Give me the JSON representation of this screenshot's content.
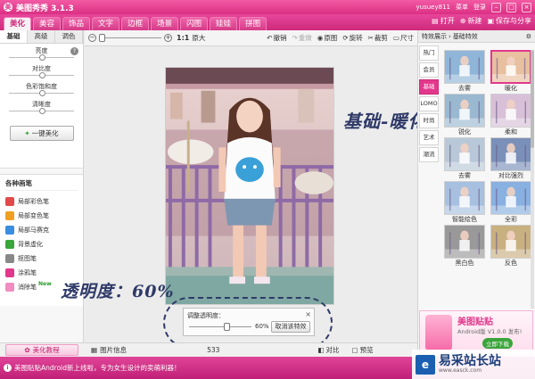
{
  "titlebar": {
    "title": "美图秀秀 3.1.3",
    "user": "yusuey811",
    "menu": "菜单",
    "login": "登录"
  },
  "menu": {
    "tabs": [
      "美化",
      "美容",
      "饰品",
      "文字",
      "边框",
      "场景",
      "闪图",
      "娃娃",
      "拼图"
    ],
    "active": 0,
    "open": "打开",
    "new": "新建",
    "save_share": "保存与分享"
  },
  "left": {
    "subtabs": [
      "基础",
      "高级",
      "调色"
    ],
    "sliders": [
      {
        "label": "亮度",
        "value": 0.5
      },
      {
        "label": "对比度",
        "value": 0.5
      },
      {
        "label": "色彩饱和度",
        "value": 0.5
      },
      {
        "label": "清晰度",
        "value": 0.5
      }
    ],
    "one_click": "一键美化",
    "brush_title": "各种画笔",
    "brushes": [
      {
        "label": "局部彩色笔",
        "color": "#e24a4a"
      },
      {
        "label": "局部变色笔",
        "color": "#f0a020"
      },
      {
        "label": "局部马赛克",
        "color": "#3a8de0"
      },
      {
        "label": "背景虚化",
        "color": "#3aa53a"
      },
      {
        "label": "抠图笔",
        "color": "#888888"
      },
      {
        "label": "涂鸦笔",
        "color": "#e2388c"
      },
      {
        "label": "消除笔",
        "color": "#f08cc0"
      }
    ],
    "new_badge": "New"
  },
  "toolbar": {
    "zoom_ratio": "1:1",
    "orig": "原大",
    "tools": [
      {
        "label": "撤销",
        "disabled": false
      },
      {
        "label": "重做",
        "disabled": true
      },
      {
        "label": "原图",
        "disabled": false
      },
      {
        "label": "旋转",
        "disabled": false
      },
      {
        "label": "裁剪",
        "disabled": false
      },
      {
        "label": "尺寸",
        "disabled": false
      }
    ]
  },
  "annotations": {
    "top": "基础-暖化",
    "bottom": "透明度：60%"
  },
  "transparency": {
    "title": "调整透明度：",
    "value": "60%",
    "cancel": "取消该特效",
    "level": 0.6
  },
  "bottom": {
    "tutorial": "美化教程",
    "image_info": "图片信息",
    "page": "533",
    "compare": "对比",
    "preview": "预览"
  },
  "status": "美图贴贴Android新上线啦，专为女生设计的卖萌利器！",
  "right": {
    "breadcrumb": [
      "特效展示",
      "基础特效"
    ],
    "categories": [
      "热门",
      "LOMO",
      "基础",
      "LOMO",
      "时尚",
      "艺术",
      "潮流"
    ],
    "category_labels": [
      "热门",
      "会员",
      "基础",
      "LOMO",
      "时尚",
      "艺术",
      "潮流"
    ],
    "active_category": 2,
    "effects": [
      {
        "label": "去雾",
        "tone": "#8fb5d8"
      },
      {
        "label": "暖化",
        "tone": "#e8c0a0"
      },
      {
        "label": "锐化",
        "tone": "#9ab8d0"
      },
      {
        "label": "柔和",
        "tone": "#d8c0d8"
      },
      {
        "label": "去雾",
        "tone": "#b8c8d8"
      },
      {
        "label": "对比强烈",
        "tone": "#7a90b8"
      },
      {
        "label": "智能绘色",
        "tone": "#a8c0e0"
      },
      {
        "label": "全彩",
        "tone": "#88b0e0"
      },
      {
        "label": "黑白色",
        "tone": "#999999"
      },
      {
        "label": "反色",
        "tone": "#c8b080"
      }
    ],
    "selected_effect": 1
  },
  "ad": {
    "title": "美图贴贴",
    "sub": "Android版 V1.0.0 发布!",
    "link": "立即下载"
  },
  "watermark": {
    "name": "易采站长站",
    "url": "www.easck.com"
  }
}
